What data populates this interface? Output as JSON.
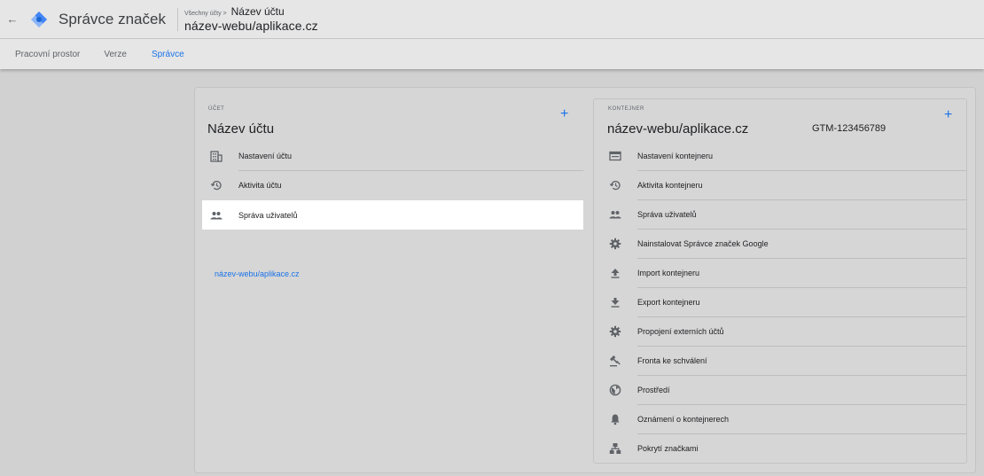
{
  "header": {
    "back_icon": "arrow-left-icon",
    "app_name": "Správce značek",
    "breadcrumb_all": "Všechny účty >",
    "breadcrumb_account": "Název účtu",
    "container_name": "název-webu/aplikace.cz"
  },
  "tabs": [
    {
      "label": "Pracovní prostor",
      "active": false
    },
    {
      "label": "Verze",
      "active": false
    },
    {
      "label": "Správce",
      "active": true
    }
  ],
  "account": {
    "label": "ÚČET",
    "title": "Název účtu",
    "add_icon": "+",
    "items": [
      {
        "label": "Nastavení účtu",
        "icon": "building-icon"
      },
      {
        "label": "Aktivita účtu",
        "icon": "history-icon"
      },
      {
        "label": "Správa uživatelů",
        "icon": "people-icon",
        "highlighted": true
      }
    ],
    "container_link": "název-webu/aplikace.cz"
  },
  "container": {
    "label": "KONTEJNER",
    "title": "název-webu/aplikace.cz",
    "gtm_id": "GTM-123456789",
    "add_icon": "+",
    "items": [
      {
        "label": "Nastavení kontejneru",
        "icon": "window-icon"
      },
      {
        "label": "Aktivita kontejneru",
        "icon": "history-icon"
      },
      {
        "label": "Správa uživatelů",
        "icon": "people-icon"
      },
      {
        "label": "Nainstalovat Správce značek Google",
        "icon": "gear-icon"
      },
      {
        "label": "Import kontejneru",
        "icon": "upload-icon"
      },
      {
        "label": "Export kontejneru",
        "icon": "download-icon"
      },
      {
        "label": "Propojení externích účtů",
        "icon": "gear-icon"
      },
      {
        "label": "Fronta ke schválení",
        "icon": "gavel-icon"
      },
      {
        "label": "Prostředí",
        "icon": "globe-icon"
      },
      {
        "label": "Oznámení o kontejnerech",
        "icon": "bell-icon"
      },
      {
        "label": "Pokrytí značkami",
        "icon": "sitemap-icon"
      }
    ]
  },
  "colors": {
    "accent": "#1a73e8",
    "background": "#d1d1d1",
    "text": "#202124"
  }
}
